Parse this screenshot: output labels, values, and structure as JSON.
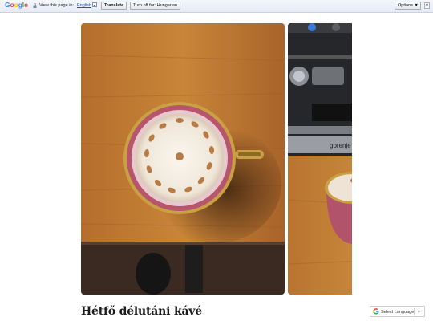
{
  "translate_bar": {
    "logo": [
      "G",
      "o",
      "o",
      "g",
      "l",
      "e"
    ],
    "logo_colors": [
      "#4285f4",
      "#ea4335",
      "#fbbc05",
      "#4285f4",
      "#34a853",
      "#ea4335"
    ],
    "prompt": "View this page in:",
    "language": "English",
    "translate_label": "Translate",
    "turn_off_label": "Turn off for: Hungarian",
    "options_label": "Options ▼",
    "close_label": "✕"
  },
  "slider": {
    "photos": [
      {
        "subject": "latte in pink cup on saucer, top view on wooden table"
      },
      {
        "subject": "gorenje espresso machine with pink cup"
      }
    ],
    "machine_brand": "gorenje"
  },
  "post": {
    "title": "Hétfő délutáni kávé"
  },
  "language_widget": {
    "label": "Select Language",
    "arrow": "▼"
  }
}
